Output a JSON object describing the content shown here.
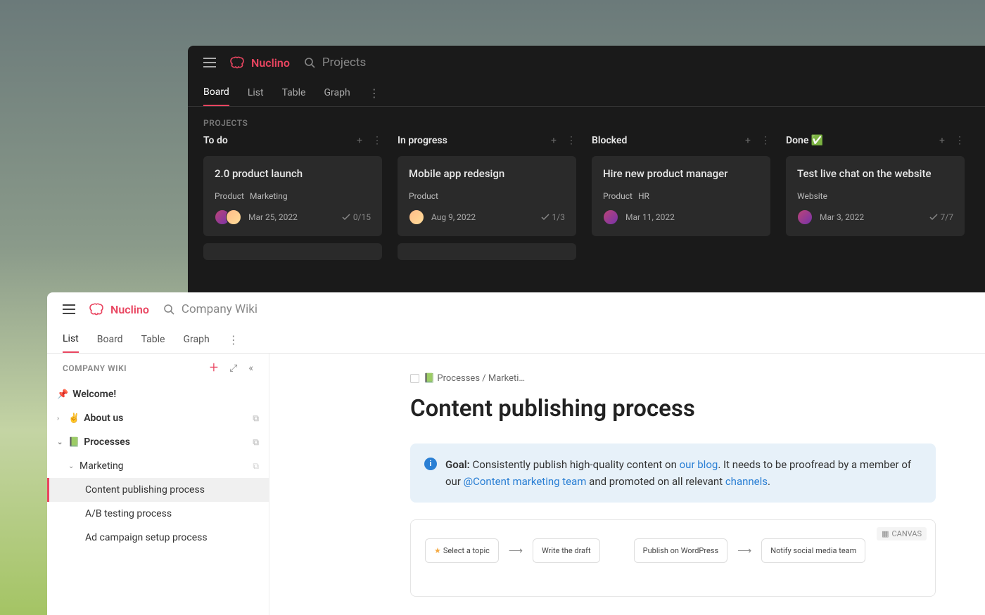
{
  "dark": {
    "brand": "Nuclino",
    "search_placeholder": "Projects",
    "tabs": [
      "Board",
      "List",
      "Table",
      "Graph"
    ],
    "active_tab": 0,
    "section_label": "PROJECTS",
    "columns": [
      {
        "title": "To do",
        "cards": [
          {
            "title": "2.0 product launch",
            "tags": [
              "Product",
              "Marketing"
            ],
            "avatars": 2,
            "date": "Mar 25, 2022",
            "progress": "0/15"
          }
        ]
      },
      {
        "title": "In progress",
        "cards": [
          {
            "title": "Mobile app redesign",
            "tags": [
              "Product"
            ],
            "avatars": 1,
            "date": "Aug 9, 2022",
            "progress": "1/3"
          }
        ]
      },
      {
        "title": "Blocked",
        "cards": [
          {
            "title": "Hire new product manager",
            "tags": [
              "Product",
              "HR"
            ],
            "avatars": 1,
            "date": "Mar 11, 2022",
            "progress": ""
          }
        ]
      },
      {
        "title": "Done ✅",
        "cards": [
          {
            "title": "Test live chat on the website",
            "tags": [
              "Website"
            ],
            "avatars": 1,
            "date": "Mar 3, 2022",
            "progress": "7/7"
          }
        ]
      }
    ]
  },
  "light": {
    "brand": "Nuclino",
    "search_placeholder": "Company Wiki",
    "tabs": [
      "List",
      "Board",
      "Table",
      "Graph"
    ],
    "active_tab": 0,
    "sidebar_title": "COMPANY WIKI",
    "tree": {
      "welcome": "Welcome!",
      "about": "About us",
      "processes": "Processes",
      "marketing": "Marketing",
      "items": [
        "Content publishing process",
        "A/B testing process",
        "Ad campaign setup process"
      ]
    },
    "breadcrumb": "📗 Processes / Marketi…",
    "page_title": "Content publishing process",
    "callout": {
      "goal_label": "Goal:",
      "text1": "Consistently publish high-quality content on ",
      "link1": "our blog",
      "text2": ". It needs to be proofread by a member of our ",
      "link2": "@Content marketing team",
      "text3": " and promoted on all relevant ",
      "link3": "channels",
      "text4": "."
    },
    "canvas_label": "CANVAS",
    "flow": [
      "Select a topic",
      "Write the draft",
      "Publish on WordPress",
      "Notify social media team"
    ]
  }
}
